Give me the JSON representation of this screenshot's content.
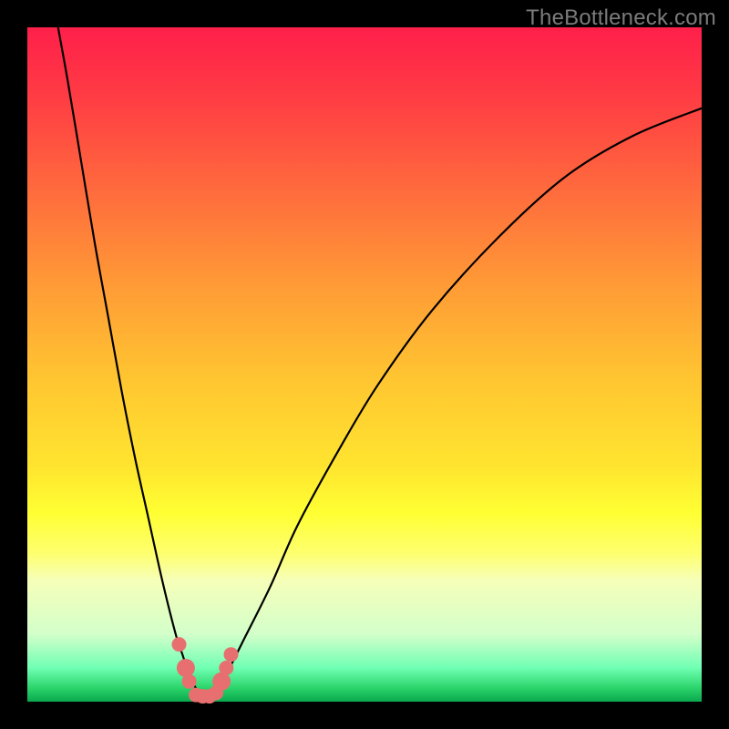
{
  "watermark": "TheBottleneck.com",
  "chart_data": {
    "type": "line",
    "title": "",
    "xlabel": "",
    "ylabel": "",
    "xlim": [
      0,
      100
    ],
    "ylim": [
      0,
      100
    ],
    "series": [
      {
        "name": "bottleneck-curve",
        "x": [
          4,
          6,
          8,
          10,
          12,
          14,
          16,
          18,
          20,
          22,
          23,
          24,
          25,
          26,
          27,
          28,
          29,
          30,
          32,
          36,
          40,
          46,
          52,
          60,
          70,
          80,
          90,
          100
        ],
        "y": [
          103,
          92,
          80,
          68,
          57,
          46,
          36,
          27,
          18,
          10,
          7,
          4,
          2,
          1,
          1,
          2,
          3,
          5,
          9,
          17,
          26,
          37,
          47,
          58,
          69,
          78,
          84,
          88
        ]
      }
    ],
    "markers": [
      {
        "x": 22.5,
        "y": 8.5,
        "r": 1.2
      },
      {
        "x": 23.5,
        "y": 5.0,
        "r": 1.5
      },
      {
        "x": 24.0,
        "y": 3.0,
        "r": 1.2
      },
      {
        "x": 25.0,
        "y": 1.0,
        "r": 1.2
      },
      {
        "x": 26.0,
        "y": 0.8,
        "r": 1.2
      },
      {
        "x": 27.0,
        "y": 0.8,
        "r": 1.2
      },
      {
        "x": 28.0,
        "y": 1.3,
        "r": 1.2
      },
      {
        "x": 28.8,
        "y": 3.0,
        "r": 1.5
      },
      {
        "x": 29.5,
        "y": 5.0,
        "r": 1.2
      },
      {
        "x": 30.2,
        "y": 7.0,
        "r": 1.2
      }
    ],
    "marker_color": "#e76f6f",
    "curve_color": "#000000"
  }
}
